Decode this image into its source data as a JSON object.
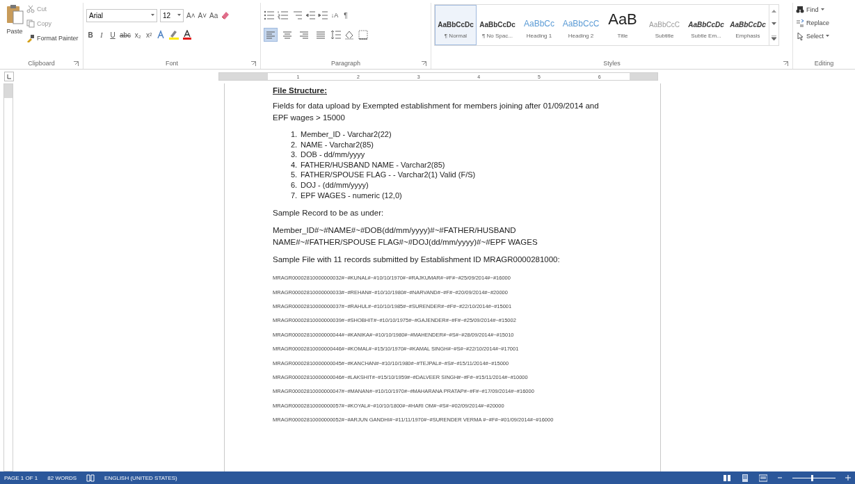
{
  "ribbon": {
    "clipboard": {
      "paste": "Paste",
      "cut": "Cut",
      "copy": "Copy",
      "format_painter": "Format Painter",
      "label": "Clipboard"
    },
    "font": {
      "name": "Arial",
      "size": "12",
      "grow": "A˄",
      "shrink": "A˅",
      "change_case": "Aa",
      "format_buttons": [
        "B",
        "I",
        "U",
        "abc",
        "x₂",
        "x²"
      ],
      "label": "Font"
    },
    "paragraph": {
      "alignments": [
        {
          "kind": "left",
          "selected": true
        },
        {
          "kind": "center",
          "selected": false
        },
        {
          "kind": "right",
          "selected": false
        },
        {
          "kind": "justify",
          "selected": false
        }
      ],
      "sort": "↓A",
      "pilcrow": "¶",
      "label": "Paragraph"
    },
    "styles": {
      "items": [
        {
          "preview": "AaBbCcDc",
          "name": "¶ Normal",
          "kind": "normal",
          "selected": true
        },
        {
          "preview": "AaBbCcDc",
          "name": "¶ No Spac...",
          "kind": "normal",
          "selected": false
        },
        {
          "preview": "AaBbCc",
          "name": "Heading 1",
          "kind": "heading",
          "selected": false
        },
        {
          "preview": "AaBbCcC",
          "name": "Heading 2",
          "kind": "heading",
          "selected": false
        },
        {
          "preview": "AaB",
          "name": "Title",
          "kind": "title",
          "selected": false
        },
        {
          "preview": "AaBbCcC",
          "name": "Subtitle",
          "kind": "subtle",
          "selected": false
        },
        {
          "preview": "AaBbCcDc",
          "name": "Subtle Em...",
          "kind": "italic",
          "selected": false
        },
        {
          "preview": "AaBbCcDc",
          "name": "Emphasis",
          "kind": "italic",
          "selected": false
        }
      ],
      "label": "Styles"
    },
    "editing": {
      "find": "Find",
      "replace": "Replace",
      "select": "Select",
      "label": "Editing"
    }
  },
  "ruler": {
    "ticks": [
      "1",
      "2",
      "3",
      "4",
      "5",
      "6"
    ]
  },
  "document": {
    "heading": "File Structure:",
    "intro": "Fields for data upload by Exempted establishment for members joining after 01/09/2014 and EPF wages > 15000",
    "fields": [
      {
        "number": "1.",
        "text": "Member_ID - Varchar2(22)"
      },
      {
        "number": "2.",
        "text": "NAME - Varchar2(85)"
      },
      {
        "number": "3.",
        "text": "DOB - dd/mm/yyyy"
      },
      {
        "number": "4.",
        "text": "FATHER/HUSBAND NAME - Varchar2(85)"
      },
      {
        "number": "5.",
        "text": "FATHER/SPOUSE FLAG - - Varchar2(1) Valid (F/S)"
      },
      {
        "number": "6.",
        "text": "DOJ - (dd/mm/yyyy)"
      },
      {
        "number": "7.",
        "text": "EPF WAGES - numeric (12,0)"
      }
    ],
    "sample_record_label": "Sample Record to be as under:",
    "sample_record_format": "Member_ID#~#NAME#~#DOB(dd/mm/yyyy)#~#FATHER/HUSBAND NAME#~#FATHER/SPOUSE FLAG#~#DOJ(dd/mm/yyyy)#~#EPF WAGES",
    "sample_file_label": "Sample File with 11 records submitted by Establishment ID MRAGR0000281000:",
    "records": [
      "MRAGR00002810000000032#~#KUNAL#~#10/10/1970#~#RAJKUMAR#~#F#~#25/09/2014#~#16000",
      "MRAGR00002810000000033#~#REHAN#~#10/10/1980#~#NARVAND#~#F#~#20/09/2014#~#20000",
      "MRAGR00002810000000037#~#RAHUL#~#10/10/1985#~#SURENDER#~#F#~#22/10/2014#~#15001",
      "MRAGR00002810000000039#~#SHOBHIT#~#10/10/1975#~#GAJENDER#~#F#~#25/09/2014#~#15002",
      "MRAGR00002810000000044#~#KANIKA#~#10/10/1980#~#MAHENDER#~#S#~#28/09/2014#~#15010",
      "MRAGR00002810000000446#~#KOMAL#~#15/10/1970#~#KAMAL SINGH#~#S#~#22/10/2014#~#17001",
      "MRAGR00002810000000045#~#KANCHAN#~#10/10/1980#~#TEJPAL#~#S#~#15/11/2014#~#15000",
      "MRAGR00002810000000046#~#LAKSHIT#~#15/10/1959#~#DALVEER SINGH#~#F#~#15/11/2014#~#10000",
      "MRAGR00002810000000047#~#MANAN#~#10/10/1970#~#MAHARANA PRATAP#~#F#~#17/09/2014#~#16000",
      "MRAGR00002810000000057#~#KOYAL#~#10/10/1800#~#HARI OM#~#S#~#02/09/2014#~#20000",
      "MRAGR00002810000000052#~#ARJUN GANDHI#~#11/11/1970#~#SURENDER VERMA #~#F#~#01/09/2014#~#16000"
    ]
  },
  "status_bar": {
    "page": "PAGE 1 OF 1",
    "words": "82 WORDS",
    "language": "ENGLISH (UNITED STATES)",
    "zoom_slider": {
      "level": 0.45
    }
  }
}
